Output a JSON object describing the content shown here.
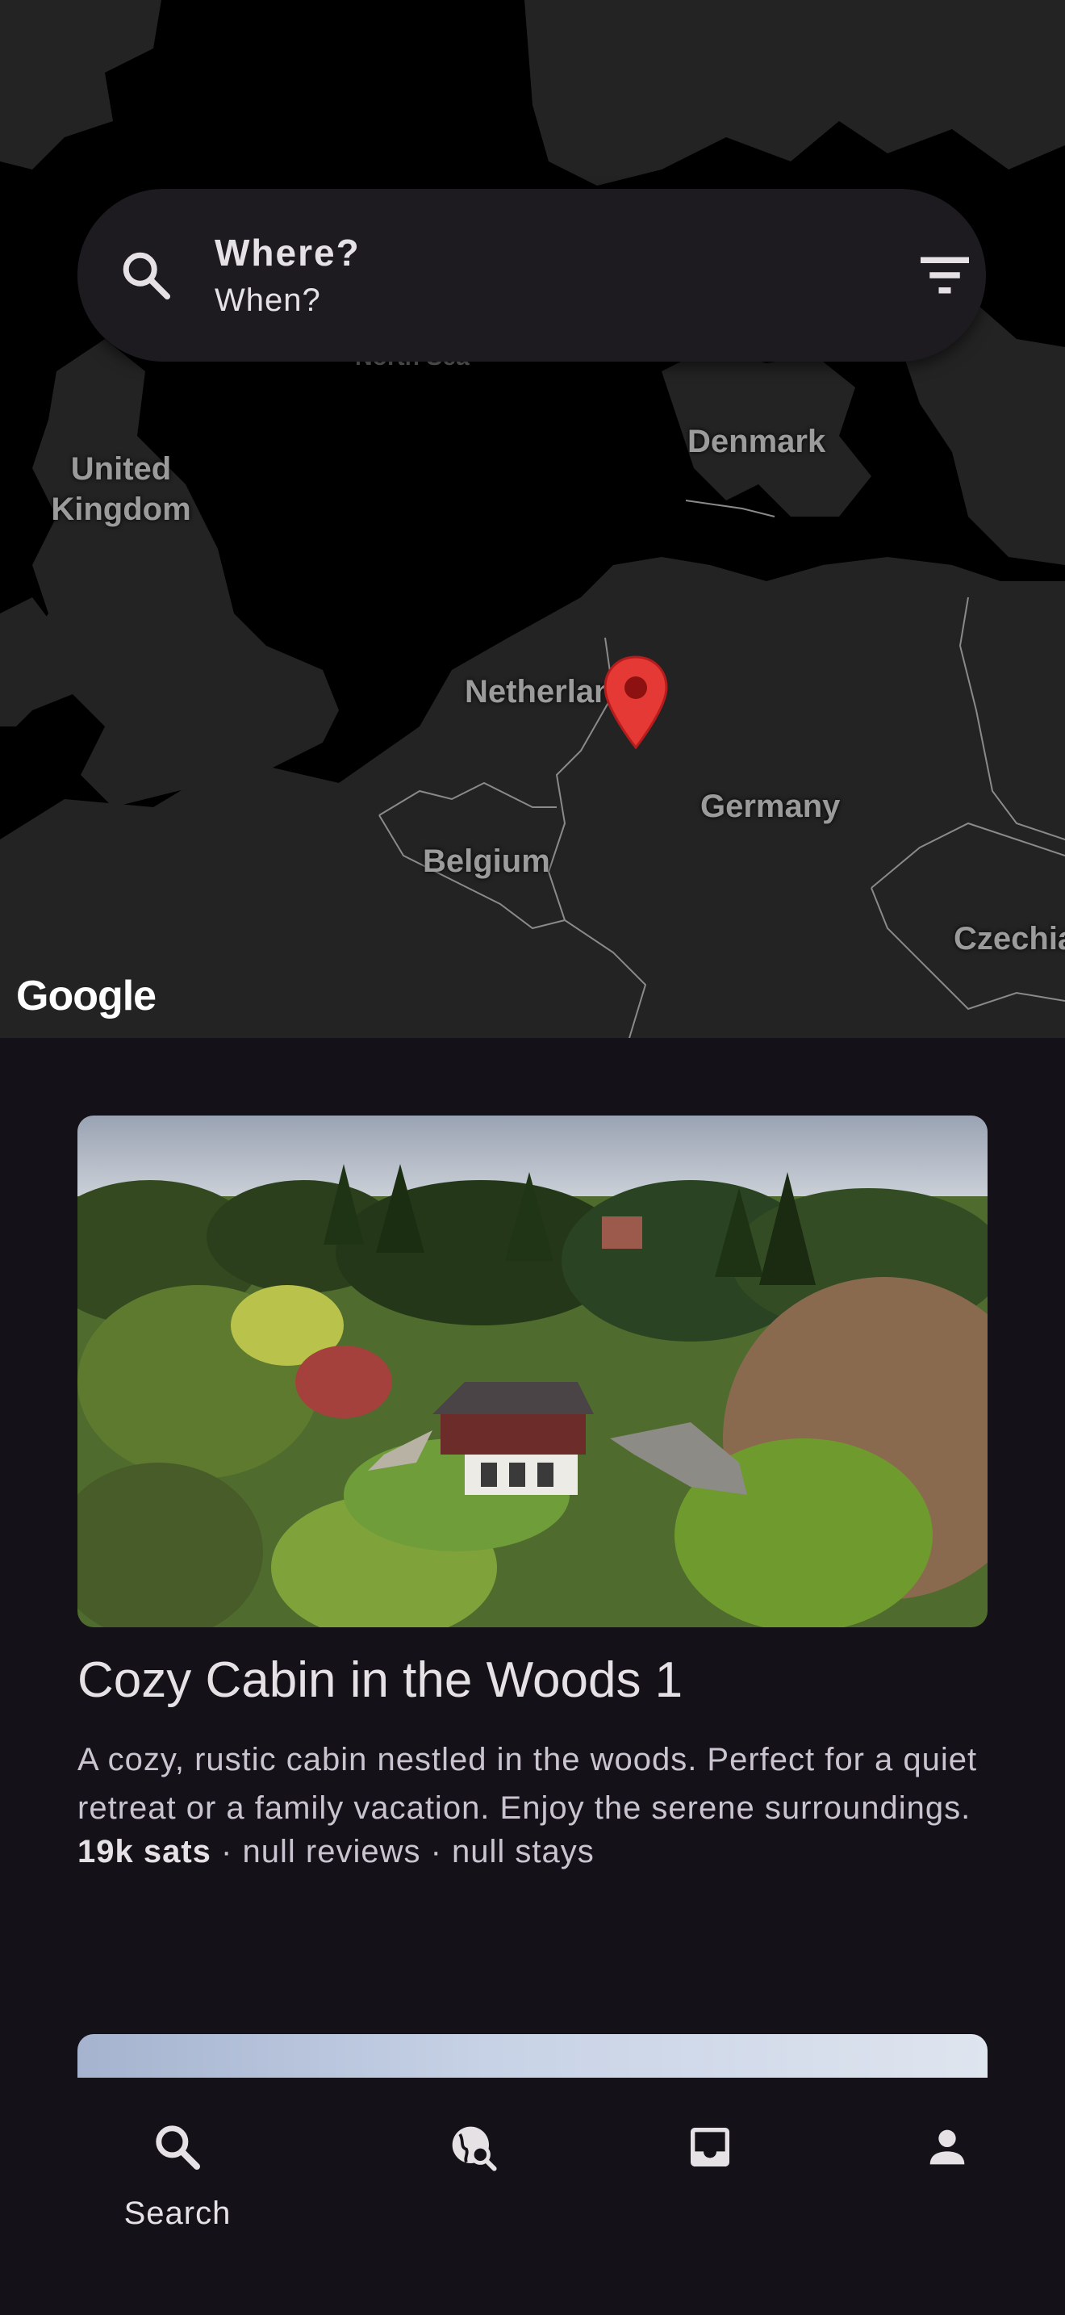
{
  "search": {
    "where": "Where?",
    "when": "When?",
    "search_icon": "search-icon",
    "filter_icon": "filter-icon"
  },
  "map": {
    "labels": {
      "north_sea": "North Sea",
      "united_kingdom": "United Kingdom",
      "denmark": "Denmark",
      "netherlands": "Netherlan",
      "germany": "Germany",
      "belgium": "Belgium",
      "czechia": "Czechia"
    },
    "attribution": "Google",
    "pin_color": "#e53935",
    "land_color": "#232323",
    "water_color": "#000000"
  },
  "listings": [
    {
      "title": "Cozy Cabin in the Woods 1",
      "description": "A cozy, rustic cabin nestled in the woods. Perfect for a quiet retreat or a family vacation. Enjoy the serene surroundings.",
      "price": "19k sats",
      "reviews": "null reviews",
      "stays": "null stays",
      "separator": "·"
    }
  ],
  "nav": {
    "items": [
      {
        "label": "Search",
        "icon": "search-icon",
        "active": true
      },
      {
        "label": "",
        "icon": "explore-search-icon",
        "active": false
      },
      {
        "label": "",
        "icon": "inbox-icon",
        "active": false
      },
      {
        "label": "",
        "icon": "person-icon",
        "active": false
      }
    ]
  },
  "colors": {
    "background": "#141218",
    "surface": "#1d1b20",
    "on_surface": "#e6e1e5"
  }
}
